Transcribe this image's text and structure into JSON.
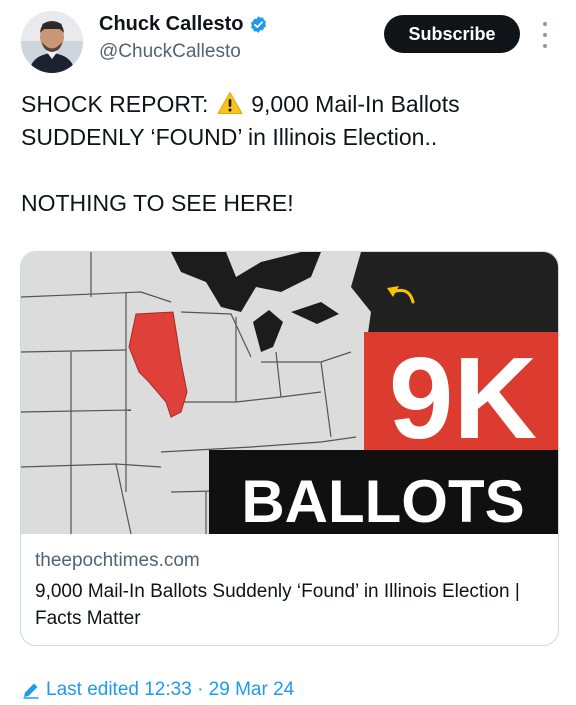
{
  "author": {
    "name": "Chuck Callesto",
    "handle": "@ChuckCallesto",
    "verified": true
  },
  "actions": {
    "subscribe_label": "Subscribe"
  },
  "tweet": {
    "line1_before_icon": "SHOCK REPORT: ",
    "line1_after_icon": " 9,000 Mail-In Ballots",
    "line2": "SUDDENLY ‘FOUND’ in Illinois Election..",
    "line3": "NOTHING TO SEE HERE!"
  },
  "card": {
    "image_big_text": "9K",
    "image_sub_text": "BALLOTS",
    "domain": "theepochtimes.com",
    "title": "9,000 Mail-In Ballots Suddenly ‘Found’ in Illinois Election | Facts Matter"
  },
  "footer": {
    "edited_label": "Last edited 12:33 · 29 Mar 24"
  },
  "colors": {
    "accent": "#1d9bf0",
    "illinois_red": "#e0403a",
    "banner_red": "#dc3b2f"
  },
  "icons": [
    "verified-badge-icon",
    "more-options-icon",
    "warning-icon",
    "edit-pencil-icon"
  ]
}
